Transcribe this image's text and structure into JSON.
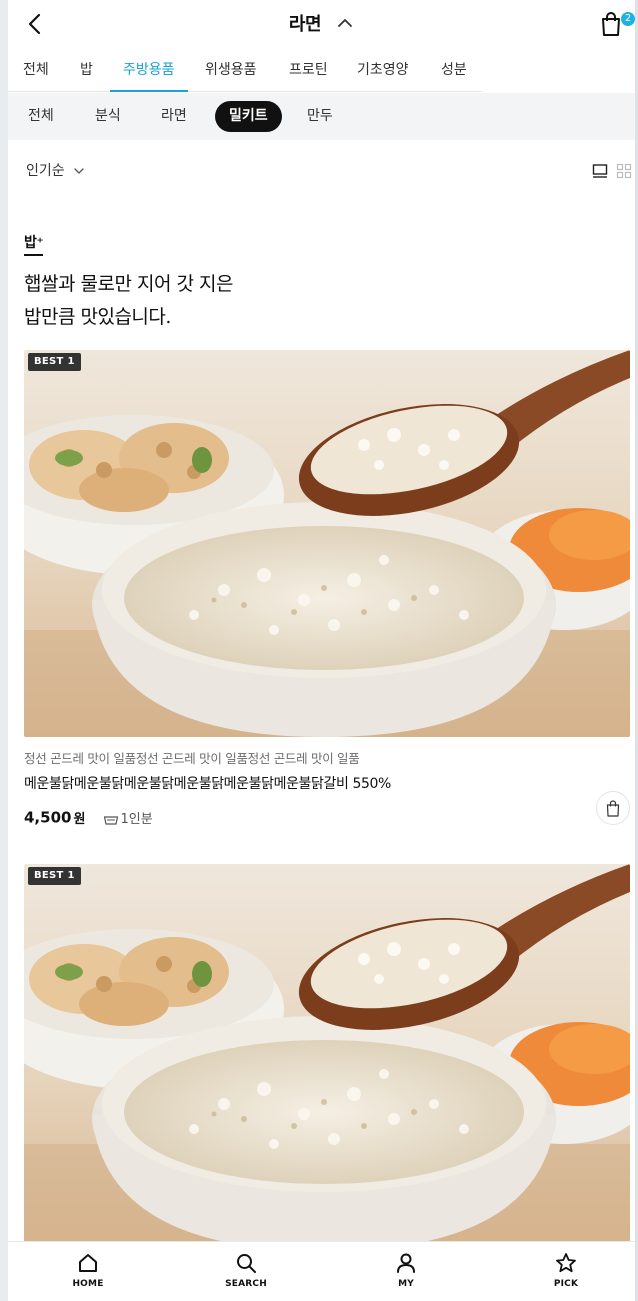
{
  "header": {
    "title": "라면",
    "cart_count": "2"
  },
  "primary_tabs": [
    {
      "label": "전체"
    },
    {
      "label": "밥"
    },
    {
      "label": "주방용품"
    },
    {
      "label": "위생용품"
    },
    {
      "label": "프로틴"
    },
    {
      "label": "기초영양"
    },
    {
      "label": "성분"
    }
  ],
  "primary_tabs_active": "주방용품",
  "sub_tabs": [
    {
      "label": "전체"
    },
    {
      "label": "분식"
    },
    {
      "label": "라면"
    },
    {
      "label": "밀키트"
    },
    {
      "label": "만두"
    }
  ],
  "sub_tabs_active": "밀키트",
  "sort": {
    "label": "인기순"
  },
  "brand": {
    "name": "밥⁺",
    "headline_line1": "햅쌀과 물로만 지어 갓 지은",
    "headline_line2": "밥만큼 맛있습니다."
  },
  "products": [
    {
      "badge": "BEST 1",
      "subtitle": "정선 곤드레 맛이 일품정선 곤드레 맛이 일품정선 곤드레 맛이 일품",
      "name": "메운불닭메운불닭메운불닭메운불닭메운불닭메운불닭갈비 550%",
      "price": "4,500",
      "currency": "원",
      "serving": "1인분"
    },
    {
      "badge": "BEST 1",
      "subtitle": "",
      "name": "",
      "price": "",
      "currency": "",
      "serving": ""
    }
  ],
  "bottom_nav": [
    {
      "label": "HOME",
      "icon": "home-icon"
    },
    {
      "label": "SEARCH",
      "icon": "search-icon"
    },
    {
      "label": "MY",
      "icon": "user-icon"
    },
    {
      "label": "PICK",
      "icon": "star-icon"
    }
  ],
  "colors": {
    "accent": "#1aa3d6",
    "badge_bg": "#333333",
    "subtab_active_bg": "#111111"
  }
}
